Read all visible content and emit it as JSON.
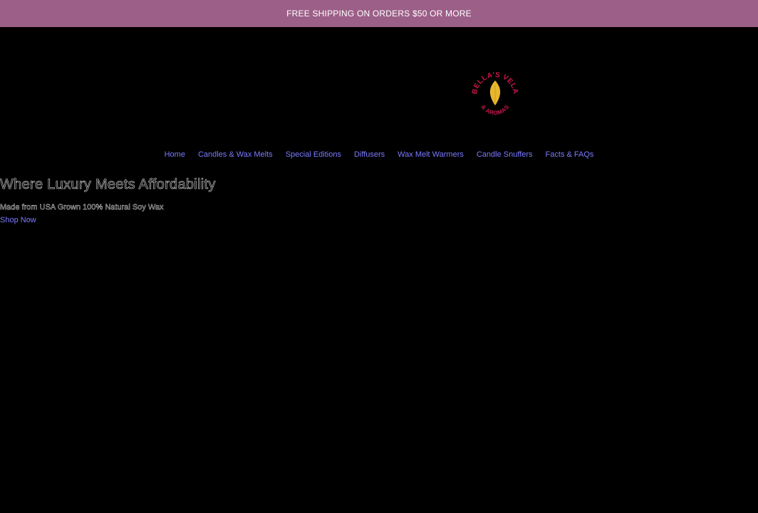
{
  "announcement": {
    "text": "FREE SHIPPING ON ORDERS $50 OR MORE"
  },
  "logo": {
    "text_top": "BELLA'S VELA",
    "text_bottom": "& AROMAS",
    "icon": "flame-icon"
  },
  "nav": {
    "items": [
      {
        "label": "Home"
      },
      {
        "label": "Candles & Wax Melts"
      },
      {
        "label": "Special Editions"
      },
      {
        "label": "Diffusers"
      },
      {
        "label": "Wax Melt Warmers"
      },
      {
        "label": "Candle Snuffers"
      },
      {
        "label": "Facts & FAQs"
      }
    ]
  },
  "hero": {
    "title": "Where Luxury Meets Affordability",
    "subtitle": "Made from USA Grown 100% Natural Soy Wax",
    "cta_label": "Shop Now"
  },
  "colors": {
    "announcement_bg": "#9c5f87",
    "page_bg": "#000000",
    "link": "#7b7bff",
    "logo_red": "#c8184a",
    "logo_flame": "#e8b62c"
  }
}
